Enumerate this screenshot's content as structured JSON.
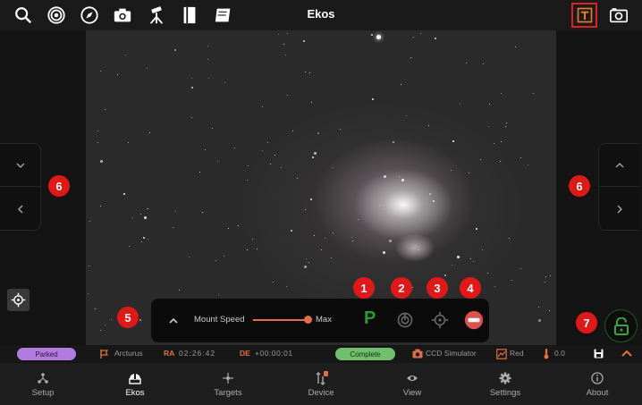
{
  "app": {
    "title": "Ekos"
  },
  "toolbar": {
    "icons": [
      "search-icon",
      "target-icon",
      "compass-icon",
      "camera-icon",
      "telescope-icon",
      "catalog-icon",
      "flat-field-icon",
      "text-overlay-icon",
      "screenshot-icon"
    ]
  },
  "callouts": {
    "c1": "1",
    "c2": "2",
    "c3": "3",
    "c4": "4",
    "c5": "5",
    "c6": "6",
    "c7": "7"
  },
  "mount": {
    "label": "Mount Speed",
    "max_label": "Max",
    "park_label": "P"
  },
  "status": {
    "park_state": "Parked",
    "target": "Arcturus",
    "ra_label": "RA",
    "ra_value": "02:26:42",
    "de_label": "DE",
    "de_value": "+00:00:01",
    "capture_state": "Complete",
    "camera": "CCD Simulator",
    "filter": "Red",
    "temperature": "0.0"
  },
  "nav": {
    "items": [
      {
        "label": "Setup"
      },
      {
        "label": "Ekos"
      },
      {
        "label": "Targets"
      },
      {
        "label": "Device"
      },
      {
        "label": "View"
      },
      {
        "label": "Settings"
      },
      {
        "label": "About"
      }
    ]
  },
  "colors": {
    "accent": "#e07040",
    "callout": "#e01818",
    "parked_pill": "#b37ae0",
    "complete_pill": "#6fbf6f",
    "park_green": "#2a9a3a"
  }
}
